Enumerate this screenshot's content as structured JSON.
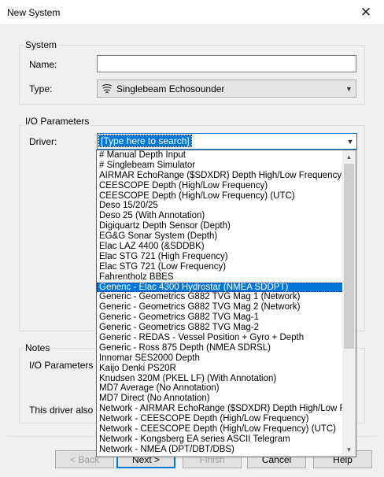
{
  "window": {
    "title": "New System"
  },
  "system_group": {
    "label": "System",
    "name_label": "Name:",
    "name_value": "",
    "type_label": "Type:",
    "type_value": "Singlebeam Echosounder",
    "type_icon": "echosounder-icon"
  },
  "io_group": {
    "label": "I/O Parameters",
    "driver_label": "Driver:",
    "driver_search_placeholder": "[Type here to search]"
  },
  "notes_group": {
    "label": "Notes",
    "line1": "I/O Parameters are",
    "line2": "This driver also sup"
  },
  "driver_list": {
    "items": [
      "# Manual Depth Input",
      "# Singlebeam Simulator",
      "AIRMAR EchoRange ($SDXDR) Depth High/Low Frequency",
      "CEESCOPE Depth (High/Low Frequency)",
      "CEESCOPE Depth (High/Low Frequency) (UTC)",
      "Deso 15/20/25",
      "Deso 25 (With Annotation)",
      "Digiquartz Depth Sensor (Depth)",
      "EG&G Sonar System (Depth)",
      "Elac LAZ 4400 (&SDDBK)",
      "Elac STG 721 (High Frequency)",
      "Elac STG 721 (Low Frequency)",
      "Fahrentholz BBES",
      "Generic - Elac 4300 Hydrostar (NMEA SDDPT)",
      "Generic - Geometrics G882 TVG Mag 1 (Network)",
      "Generic - Geometrics G882 TVG Mag 2 (Network)",
      "Generic - Geometrics G882 TVG Mag-1",
      "Generic - Geometrics G882 TVG Mag-2",
      "Generic - REDAS - Vessel Position + Gyro + Depth",
      "Generic - Ross 875 Depth (NMEA SDRSL)",
      "Innomar SES2000 Depth",
      "Kaijo Denki PS20R",
      "Knudsen 320M (PKEL LF) (With Annotation)",
      "MD7 Average (No Annotation)",
      "MD7 Direct  (No Annotation)",
      "Network - AIRMAR EchoRange ($SDXDR) Depth High/Low Freq",
      "Network - CEESCOPE Depth (High/Low Frequency)",
      "Network - CEESCOPE Depth (High/Low Frequency) (UTC)",
      "Network - Kongsberg EA series ASCII Telegram",
      "Network - NMEA (DPT/DBT/DBS)"
    ],
    "selected_index": 13
  },
  "buttons": {
    "back": "< Back",
    "next": "Next >",
    "finish": "Finish",
    "cancel": "Cancel",
    "help": "Help"
  },
  "colors": {
    "accent": "#0078d7"
  }
}
